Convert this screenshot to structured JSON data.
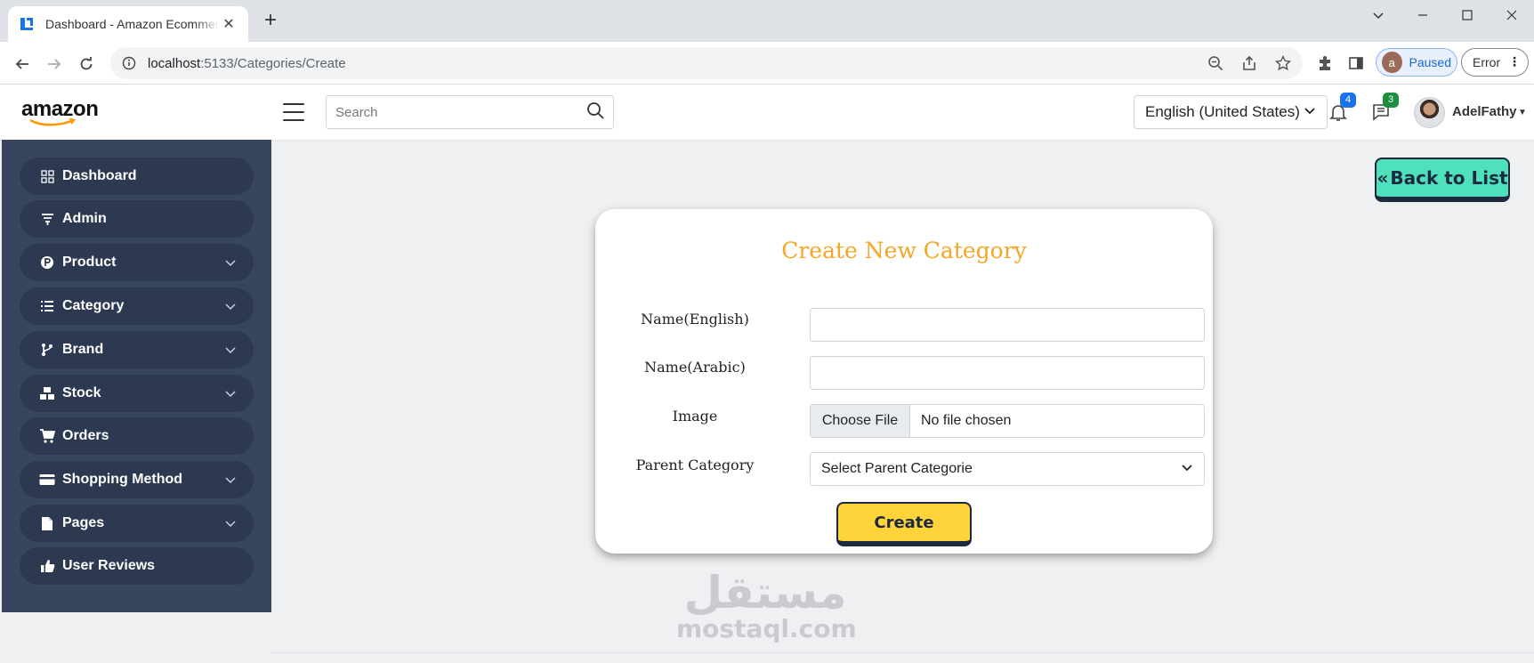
{
  "browser": {
    "tab_title": "Dashboard - Amazon Ecommerce",
    "url_host": "localhost",
    "url_rest": ":5133/Categories/Create",
    "profile_initial": "a",
    "profile_status": "Paused",
    "error_label": "Error"
  },
  "header": {
    "logo_text": "amazon",
    "search_placeholder": "Search",
    "language": "English (United States)",
    "notifications_count": "4",
    "messages_count": "3",
    "user_name": "AdelFathy",
    "colors": {
      "notif_badge": "#1a73e8",
      "msg_badge": "#1e8e3e"
    }
  },
  "sidebar": {
    "items": [
      {
        "label": "Dashboard",
        "icon": "grid-icon",
        "has_children": false
      },
      {
        "label": "Admin",
        "icon": "filter-icon",
        "has_children": false
      },
      {
        "label": "Product",
        "icon": "product-icon",
        "has_children": true
      },
      {
        "label": "Category",
        "icon": "list-icon",
        "has_children": true
      },
      {
        "label": "Brand",
        "icon": "branch-icon",
        "has_children": true
      },
      {
        "label": "Stock",
        "icon": "boxes-icon",
        "has_children": true
      },
      {
        "label": "Orders",
        "icon": "cart-icon",
        "has_children": false
      },
      {
        "label": "Shopping Method",
        "icon": "card-icon",
        "has_children": true
      },
      {
        "label": "Pages",
        "icon": "file-icon",
        "has_children": true
      },
      {
        "label": "User Reviews",
        "icon": "thumbs-up-icon",
        "has_children": false
      }
    ]
  },
  "main": {
    "back_button": "Back to List",
    "form": {
      "title": "Create New Category",
      "name_en_label": "Name(English)",
      "name_en_value": "",
      "name_ar_label": "Name(Arabic)",
      "name_ar_value": "",
      "image_label": "Image",
      "file_button": "Choose File",
      "file_status": "No file chosen",
      "parent_label": "Parent Category",
      "parent_selected": "Select Parent Categorie",
      "submit": "Create"
    }
  },
  "watermark": {
    "arabic": "مستقل",
    "latin": "mostaql.com"
  }
}
